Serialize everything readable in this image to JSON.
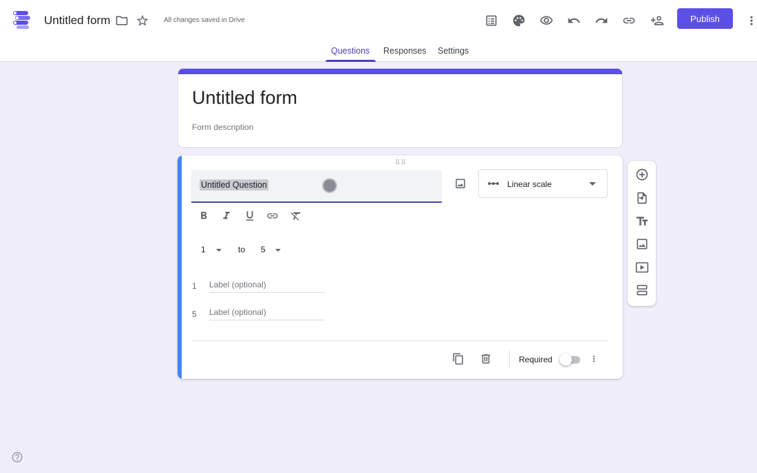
{
  "header": {
    "form_name": "Untitled form",
    "saved_status": "All changes saved in Drive",
    "publish_label": "Publish",
    "accent_color": "#5b4fe6",
    "icons": [
      "folder-icon",
      "star-icon",
      "customize-icon",
      "palette-icon",
      "preview-icon",
      "undo-icon",
      "redo-icon",
      "link-icon",
      "add-collaborator-icon",
      "more-vert-icon"
    ]
  },
  "tabs": [
    {
      "label": "Questions",
      "active": true
    },
    {
      "label": "Responses",
      "active": false
    },
    {
      "label": "Settings",
      "active": false
    }
  ],
  "title_card": {
    "title": "Untitled form",
    "description_placeholder": "Form description"
  },
  "question": {
    "text": "Untitled Question",
    "type": "Linear scale",
    "scale_min": "1",
    "scale_to": "to",
    "scale_max": "5",
    "low_label_num": "1",
    "low_label_placeholder": "Label (optional)",
    "high_label_num": "5",
    "high_label_placeholder": "Label (optional)",
    "required_label": "Required",
    "required": false
  },
  "side_toolbar": [
    "add-question-icon",
    "import-questions-icon",
    "add-title-icon",
    "add-image-icon",
    "add-video-icon",
    "add-section-icon"
  ]
}
